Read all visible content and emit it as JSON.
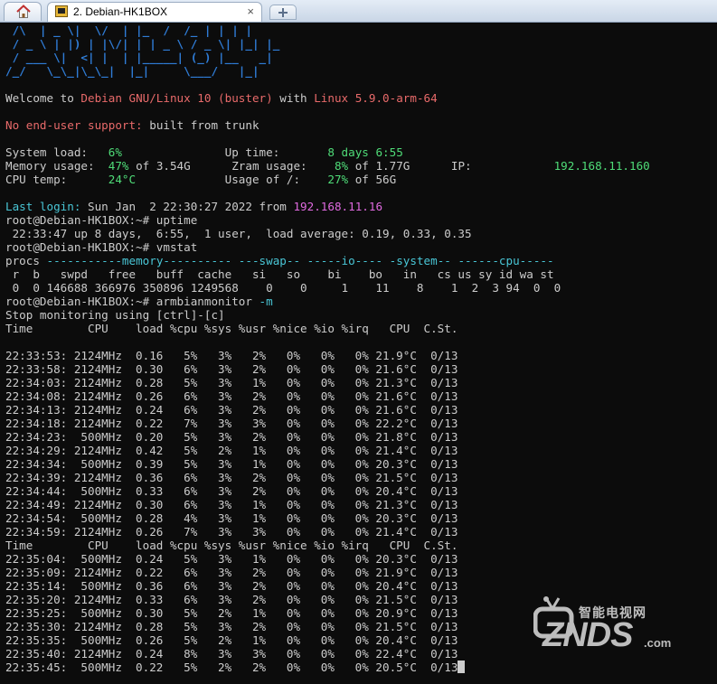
{
  "window": {
    "tab_title": "2. Debian-HK1BOX",
    "tab_close": "×"
  },
  "terminal": {
    "logo": [
      " /\\  | _ \\|  \\/  | |_  /  /_ | | | |",
      " / _ \\ | |) | |\\/| | | _ \\ / _ \\| |_| |_",
      " / ___ \\|  <| |  | |_____| (_) |__   _|",
      "/_/   \\_\\_|\\_\\_|  |_|     \\___/   |_|"
    ],
    "welcome": {
      "pre": "Welcome to ",
      "os": "Debian GNU/Linux 10 (buster)",
      "mid": " with ",
      "kernel": "Linux 5.9.0-arm-64"
    },
    "support": {
      "label": "No end-user support:",
      "text": " built from trunk"
    },
    "stats": [
      {
        "label": "System load:   ",
        "value": "6%",
        "rest": "               Up time:       ",
        "value2": "8 days 6:55",
        "rest2": "",
        "value3": ""
      },
      {
        "label": "Memory usage:  ",
        "value": "47%",
        "rest": " of 3.54G      Zram usage:    ",
        "value2": "8%",
        "rest2": " of 1.77G      IP:            ",
        "value3": "192.168.11.160"
      },
      {
        "label": "CPU temp:      ",
        "value": "24°C",
        "rest": "             Usage of /:    ",
        "value2": "27%",
        "rest2": " of 56G",
        "value3": ""
      }
    ],
    "last_login": {
      "label": "Last login:",
      "text": " Sun Jan  2 22:30:27 2022 from ",
      "ip": "192.168.11.16"
    },
    "lines1": [
      "root@Debian-HK1BOX:~# uptime",
      " 22:33:47 up 8 days,  6:55,  1 user,  load average: 0.19, 0.33, 0.35",
      "root@Debian-HK1BOX:~# vmstat"
    ],
    "vmstat_groups": {
      "procs": "procs ",
      "memory": "-----------memory----------",
      "swap": " ---swap-- ",
      "io": "-----io----",
      "system": " -system-- ",
      "cpu": "------cpu-----"
    },
    "lines2": [
      " r  b   swpd   free   buff  cache   si   so    bi    bo   in   cs us sy id wa st",
      " 0  0 146688 366976 350896 1249568    0    0     1    11    8    1  2  3 94  0  0"
    ],
    "monitor_cmd": {
      "pre": "root@Debian-HK1BOX:~# armbianmonitor ",
      "flag": "-m"
    },
    "stop_line": "Stop monitoring using [ctrl]-[c]",
    "header": "Time        CPU    load %cpu %sys %usr %nice %io %irq   CPU  C.St.",
    "rows1": [
      "22:33:53: 2124MHz  0.16   5%   3%   2%   0%   0%   0% 21.9°C  0/13",
      "22:33:58: 2124MHz  0.30   6%   3%   2%   0%   0%   0% 21.6°C  0/13",
      "22:34:03: 2124MHz  0.28   5%   3%   1%   0%   0%   0% 21.3°C  0/13",
      "22:34:08: 2124MHz  0.26   6%   3%   2%   0%   0%   0% 21.6°C  0/13",
      "22:34:13: 2124MHz  0.24   6%   3%   2%   0%   0%   0% 21.6°C  0/13",
      "22:34:18: 2124MHz  0.22   7%   3%   3%   0%   0%   0% 22.2°C  0/13",
      "22:34:23:  500MHz  0.20   5%   3%   2%   0%   0%   0% 21.8°C  0/13",
      "22:34:29: 2124MHz  0.42   5%   2%   1%   0%   0%   0% 21.4°C  0/13",
      "22:34:34:  500MHz  0.39   5%   3%   1%   0%   0%   0% 20.3°C  0/13",
      "22:34:39: 2124MHz  0.36   6%   3%   2%   0%   0%   0% 21.5°C  0/13",
      "22:34:44:  500MHz  0.33   6%   3%   2%   0%   0%   0% 20.4°C  0/13",
      "22:34:49: 2124MHz  0.30   6%   3%   1%   0%   0%   0% 21.3°C  0/13",
      "22:34:54:  500MHz  0.28   4%   3%   1%   0%   0%   0% 20.3°C  0/13",
      "22:34:59: 2124MHz  0.26   7%   3%   3%   0%   0%   0% 21.4°C  0/13"
    ],
    "rows2": [
      "22:35:04:  500MHz  0.24   5%   3%   1%   0%   0%   0% 20.3°C  0/13",
      "22:35:09: 2124MHz  0.22   6%   3%   2%   0%   0%   0% 21.9°C  0/13",
      "22:35:14:  500MHz  0.36   6%   3%   2%   0%   0%   0% 20.4°C  0/13",
      "22:35:20: 2124MHz  0.33   6%   3%   2%   0%   0%   0% 21.5°C  0/13",
      "22:35:25:  500MHz  0.30   5%   2%   1%   0%   0%   0% 20.9°C  0/13",
      "22:35:30: 2124MHz  0.28   5%   3%   2%   0%   0%   0% 21.5°C  0/13",
      "22:35:35:  500MHz  0.26   5%   2%   1%   0%   0%   0% 20.4°C  0/13",
      "22:35:40: 2124MHz  0.24   8%   3%   3%   0%   0%   0% 22.4°C  0/13"
    ],
    "last_row": "22:35:45:  500MHz  0.22   5%   2%   2%   0%   0%   0% 20.5°C  0/13"
  },
  "watermark": {
    "cn": "智能电视网",
    "name": "ZNDS",
    "domain": ".com"
  },
  "colors": {
    "background": "#0c0c0c",
    "text": "#cccccc",
    "logo": "#2f7cd6",
    "red": "#e86a6a",
    "green": "#4fdc78",
    "cyan": "#49c6d6",
    "magenta": "#e06ae0"
  }
}
